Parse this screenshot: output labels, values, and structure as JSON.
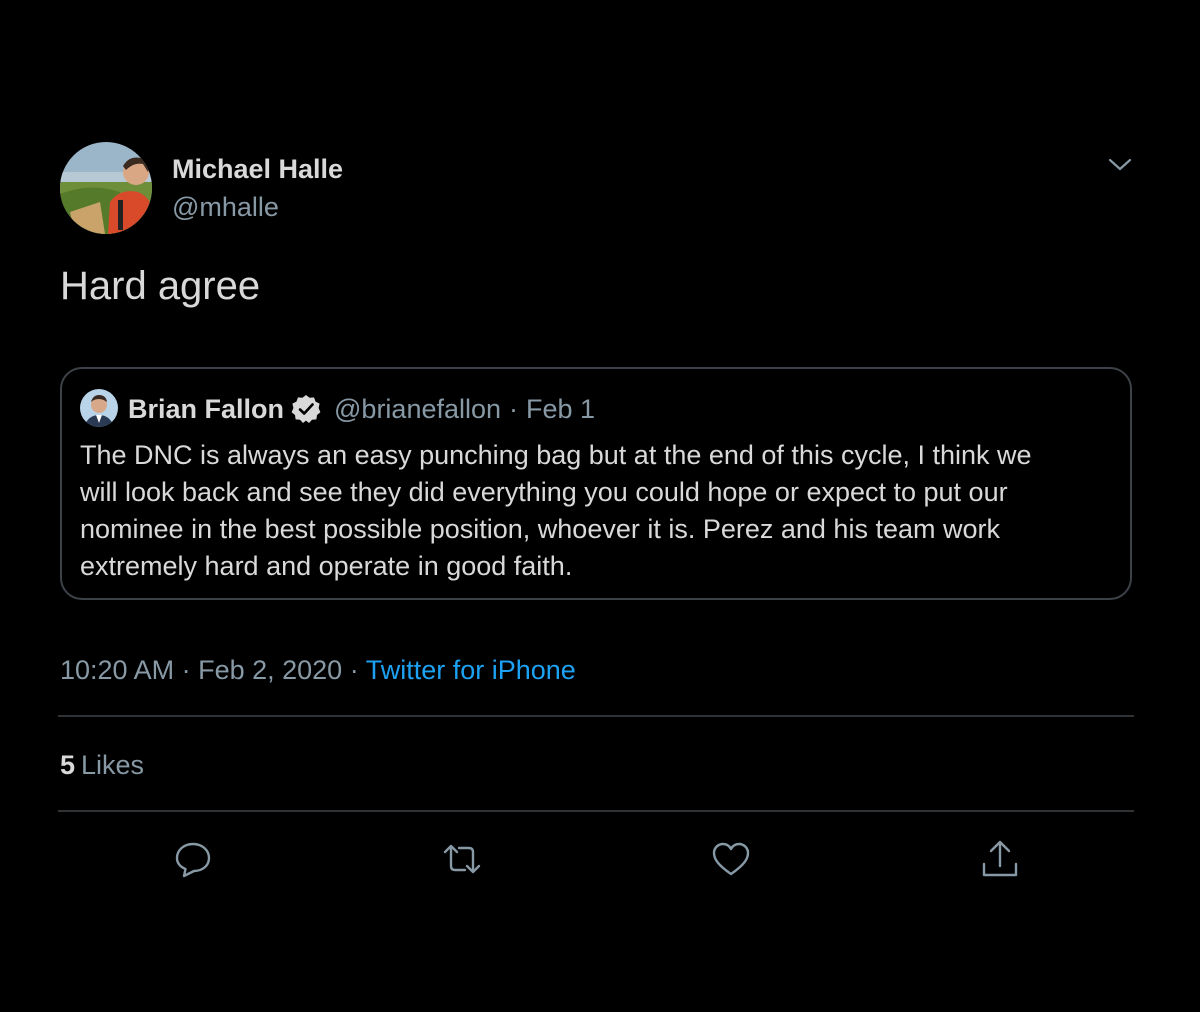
{
  "tweet": {
    "author_name": "Michael Halle",
    "author_handle": "@mhalle",
    "text": "Hard agree",
    "timestamp": "10:20 AM · Feb 2, 2020",
    "separator": " · ",
    "source": "Twitter for iPhone",
    "likes_count": "5",
    "likes_label": "Likes"
  },
  "quoted_tweet": {
    "author_name": "Brian Fallon",
    "author_handle": "@brianefallon",
    "separator": "·",
    "date": "Feb 1",
    "verified": true,
    "lines": [
      "The DNC is always an easy punching bag but at the end of this cycle, I think we",
      "will look back and see they did everything you could hope or expect to put our",
      "nominee in the best possible position, whoever it is. Perez and his team work",
      "extremely hard and operate in good faith."
    ]
  },
  "icons": {
    "menu": "chevron-down-icon",
    "reply": "reply-icon",
    "retweet": "retweet-icon",
    "like": "heart-icon",
    "share": "share-icon",
    "verified": "verified-badge-icon"
  },
  "colors": {
    "background": "#000000",
    "text": "#d9d9d9",
    "secondary": "#8899a6",
    "link": "#1da1f2",
    "border": "#3d4248",
    "divider": "#2f3336",
    "icon": "#8899a6"
  }
}
